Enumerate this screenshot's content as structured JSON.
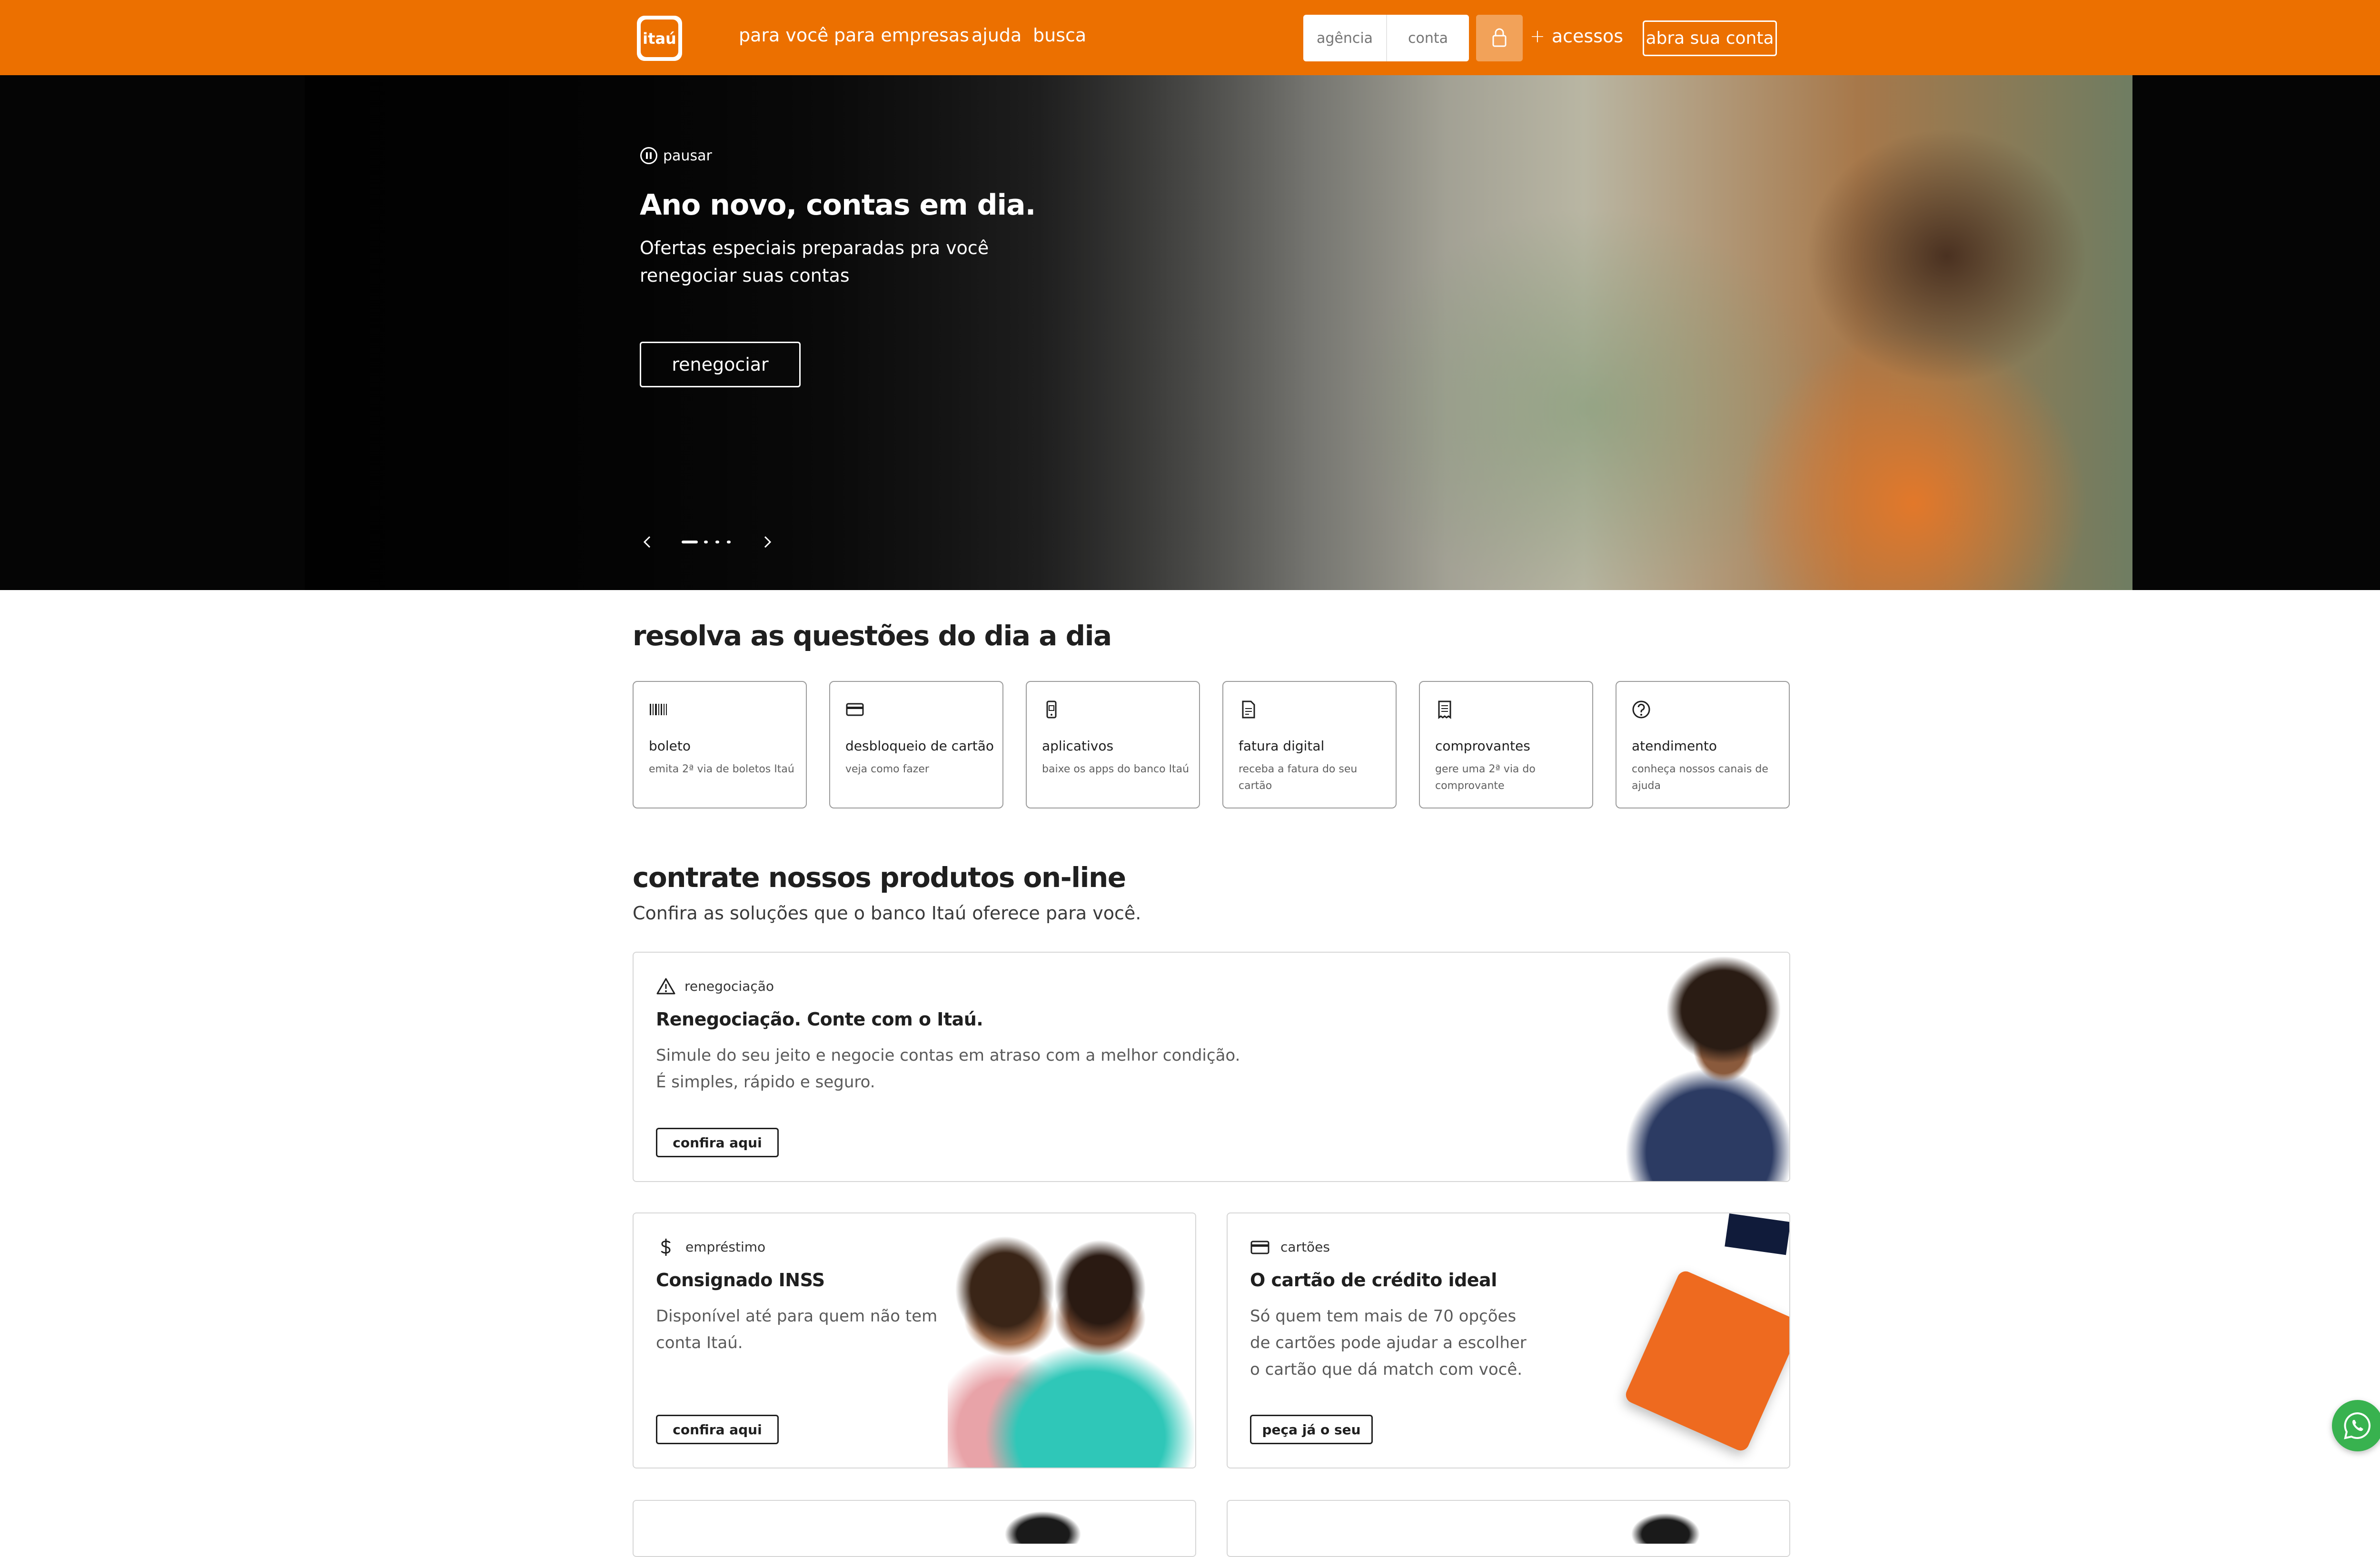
{
  "header": {
    "logo_text": "itaú",
    "nav": [
      "para você",
      "para empresas",
      "ajuda",
      "busca"
    ],
    "login": {
      "agencia_placeholder": "agência",
      "conta_placeholder": "conta"
    },
    "acessos": "acessos",
    "open_account": "abra sua conta"
  },
  "colors": {
    "brand_orange": "#ec7000",
    "a11y_blue": "#0f3d8c",
    "whatsapp_green": "#38b24f"
  },
  "hero": {
    "pause": "pausar",
    "title": "Ano novo, contas em dia.",
    "subtitle": "Ofertas especiais preparadas pra você renegociar suas contas",
    "button": "renegociar",
    "slides_total": 4,
    "active_slide": 1
  },
  "quick": {
    "title": "resolva as questões do dia a dia",
    "items": [
      {
        "icon": "barcode-icon",
        "title": "boleto",
        "desc": "emita 2ª via de boletos Itaú"
      },
      {
        "icon": "card-icon",
        "title": "desbloqueio de cartão",
        "desc": "veja como fazer"
      },
      {
        "icon": "phone-icon",
        "title": "aplicativos",
        "desc": "baixe os apps do banco Itaú"
      },
      {
        "icon": "invoice-icon",
        "title": "fatura digital",
        "desc": "receba a fatura do seu cartão"
      },
      {
        "icon": "receipt-icon",
        "title": "comprovantes",
        "desc": "gere uma 2ª via do comprovante"
      },
      {
        "icon": "question-icon",
        "title": "atendimento",
        "desc": "conheça nossos canais de ajuda"
      }
    ]
  },
  "products": {
    "title": "contrate nossos produtos on-line",
    "subtitle": "Confira as soluções que o banco Itaú oferece para você.",
    "cards": [
      {
        "icon": "warning-icon",
        "tag": "renegociação",
        "title": "Renegociação. Conte com o Itaú.",
        "desc": "Simule do seu jeito e negocie contas em atraso com a melhor condição. É simples, rápido e seguro.",
        "button": "confira aqui"
      },
      {
        "icon": "dollar-icon",
        "tag": "empréstimo",
        "title": "Consignado INSS",
        "desc": "Disponível até para quem não tem conta Itaú.",
        "button": "confira aqui"
      },
      {
        "icon": "card-icon",
        "tag": "cartões",
        "title": "O cartão de crédito ideal",
        "desc": "Só quem tem mais de 70 opções de cartões pode ajudar a escolher o cartão que dá match com você.",
        "button": "peça já o seu"
      }
    ]
  }
}
